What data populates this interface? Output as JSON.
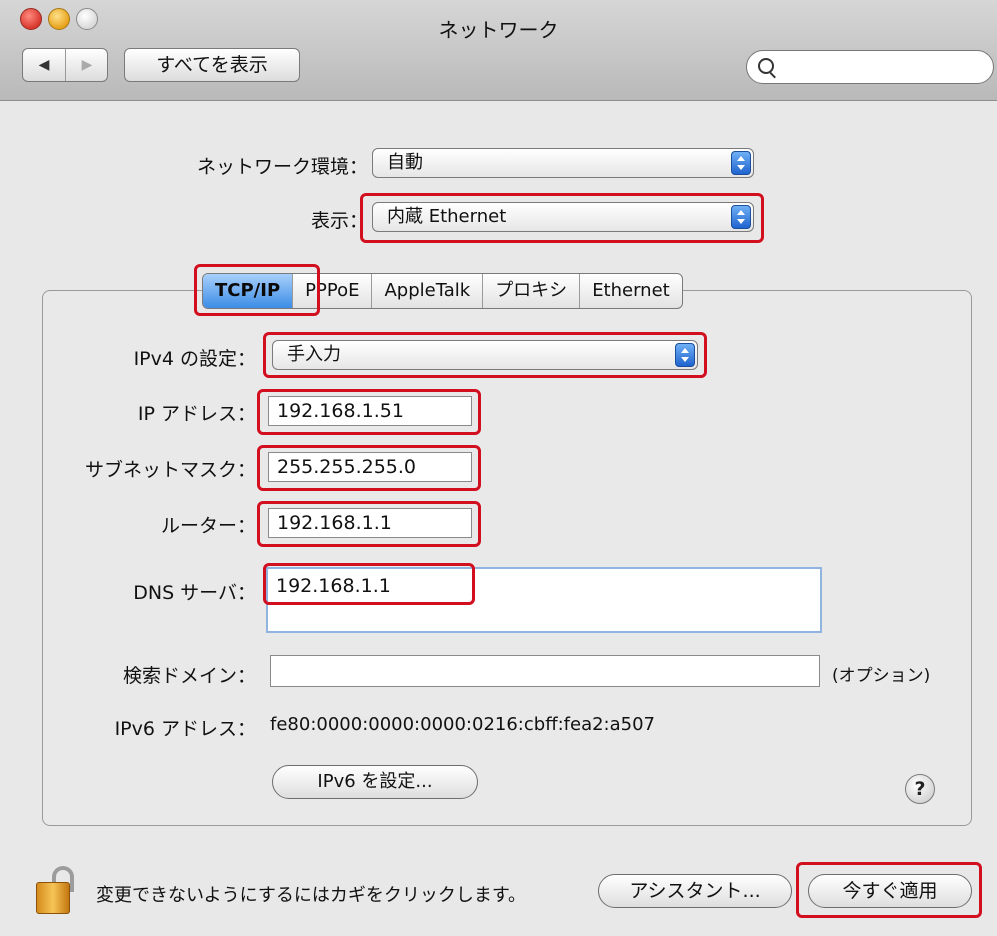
{
  "window": {
    "title": "ネットワーク"
  },
  "toolbar": {
    "back_glyph": "◀",
    "forward_glyph": "▶",
    "show_all_label": "すべてを表示",
    "search_placeholder": ""
  },
  "location": {
    "label": "ネットワーク環境：",
    "value": "自動"
  },
  "show": {
    "label": "表示：",
    "value": "内蔵 Ethernet"
  },
  "tabs": [
    {
      "label": "TCP/IP",
      "active": true
    },
    {
      "label": "PPPoE",
      "active": false
    },
    {
      "label": "AppleTalk",
      "active": false
    },
    {
      "label": "プロキシ",
      "active": false
    },
    {
      "label": "Ethernet",
      "active": false
    }
  ],
  "tcpip": {
    "ipv4_label": "IPv4 の設定：",
    "ipv4_value": "手入力",
    "ip_label": "IP アドレス：",
    "ip_value": "192.168.1.51",
    "subnet_label": "サブネットマスク：",
    "subnet_value": "255.255.255.0",
    "router_label": "ルーター：",
    "router_value": "192.168.1.1",
    "dns_label": "DNS サーバ：",
    "dns_value": "192.168.1.1",
    "search_domain_label": "検索ドメイン：",
    "search_domain_value": "",
    "optional_label": "(オプション)",
    "ipv6_label": "IPv6 アドレス：",
    "ipv6_value": "fe80:0000:0000:0000:0216:cbff:fea2:a507",
    "ipv6_button": "IPv6 を設定...",
    "help_glyph": "?"
  },
  "footer": {
    "lock_text": "変更できないようにするにはカギをクリックします。",
    "assistant_button": "アシスタント...",
    "apply_button": "今すぐ適用"
  },
  "colors": {
    "highlight_border": "#d20f1f",
    "active_tab": "#3c8ce6"
  }
}
